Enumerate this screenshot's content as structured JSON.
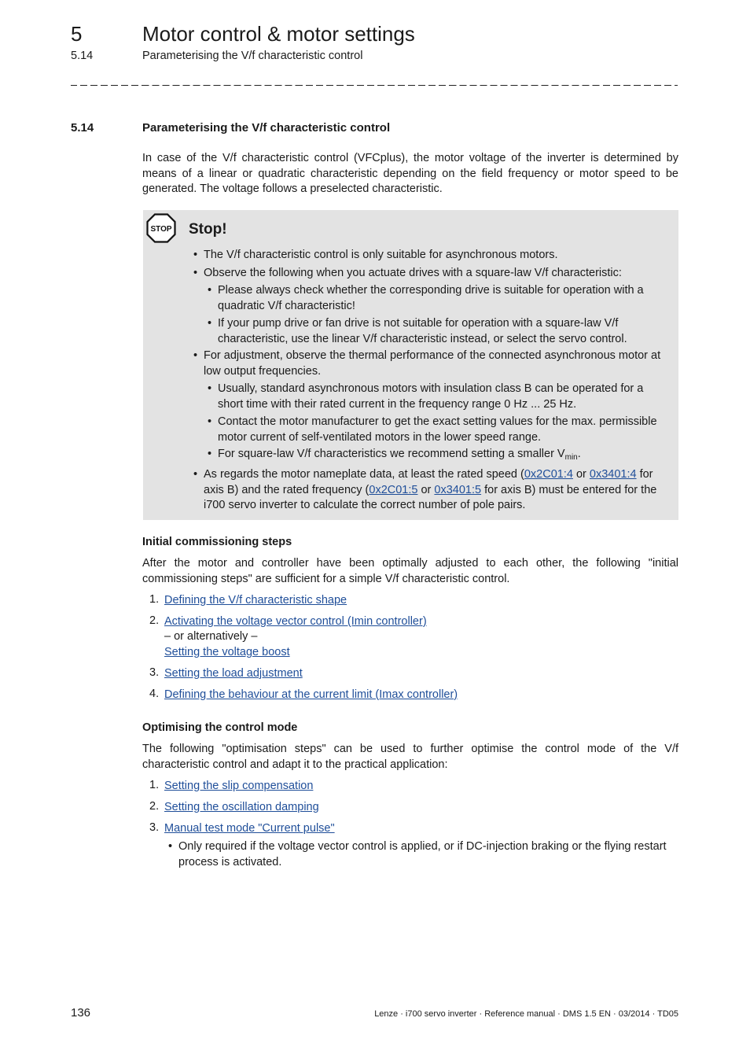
{
  "header": {
    "chapter_number": "5",
    "chapter_title": "Motor control & motor settings",
    "section_number": "5.14",
    "section_title": "Parameterising the V/f characteristic control"
  },
  "section": {
    "number": "5.14",
    "title": "Parameterising the V/f characteristic control",
    "intro": "In case of the V/f characteristic control (VFCplus), the motor voltage of the inverter is determined by means of a linear or quadratic characteristic depending on the field frequency or motor speed to be generated. The voltage follows a preselected characteristic."
  },
  "stop_box": {
    "icon": "stop-sign-icon",
    "icon_text": "STOP",
    "label": "Stop!",
    "b1": "The V/f characteristic control is only suitable for asynchronous motors.",
    "b2": "Observe the following when you actuate drives with a square-law V/f characteristic:",
    "b2_1": "Please always check whether the corresponding drive is suitable for operation with a quadratic V/f characteristic!",
    "b2_2": "If your pump drive or fan drive is not suitable for operation with a square-law V/f characteristic, use the linear V/f characteristic instead, or select the servo control.",
    "b3": "For adjustment, observe the thermal performance of the connected asynchronous motor at low output frequencies.",
    "b3_1": "Usually, standard asynchronous motors with insulation class B can be operated for a short time with their rated current in the frequency range 0 Hz ... 25 Hz.",
    "b3_2": "Contact the motor manufacturer to get the exact setting values for the max. permissible motor current of self-ventilated motors in the lower speed range.",
    "b3_3_pre": "For square-law V/f characteristics we recommend setting a smaller V",
    "b3_3_sub": "min",
    "b3_3_post": ".",
    "b4_a": "As regards the motor nameplate data, at least the rated speed (",
    "b4_link1": "0x2C01:4",
    "b4_b": " or ",
    "b4_link2": "0x3401:4",
    "b4_c": " for axis B) and the rated frequency (",
    "b4_link3": "0x2C01:5",
    "b4_d": " or ",
    "b4_link4": "0x3401:5",
    "b4_e": " for axis B) must be entered for the i700 servo inverter to calculate the correct number of pole pairs."
  },
  "initial": {
    "heading": "Initial commissioning steps",
    "text": "After the motor and controller have been optimally adjusted to each other, the following \"initial commissioning steps\" are sufficient for a simple V/f characteristic control.",
    "steps": [
      {
        "num": "1.",
        "label": "Defining the V/f characteristic shape"
      },
      {
        "num": "2.",
        "label": "Activating the voltage vector control (Imin controller)"
      },
      {
        "num": "3.",
        "label": "Setting the load adjustment"
      },
      {
        "num": "4.",
        "label": "Defining the behaviour at the current limit (Imax controller)"
      }
    ],
    "alt_text": "– or alternatively –",
    "alt_link": "Setting the voltage boost"
  },
  "optimising": {
    "heading": "Optimising the control mode",
    "text": "The following \"optimisation steps\" can be used to further optimise the control mode of the V/f characteristic control and adapt it to the practical application:",
    "steps": [
      {
        "num": "1.",
        "label": "Setting the slip compensation"
      },
      {
        "num": "2.",
        "label": "Setting the oscillation damping"
      },
      {
        "num": "3.",
        "label": "Manual test mode \"Current pulse\""
      }
    ],
    "note": "Only required if the voltage vector control is applied, or if DC-injection braking or the flying restart process is activated."
  },
  "footer": {
    "page_number": "136",
    "doc_info": "Lenze · i700 servo inverter · Reference manual · DMS 1.5 EN · 03/2014 · TD05"
  },
  "colors": {
    "link": "#1f4e99",
    "stop_box_bg": "#e3e3e3"
  }
}
